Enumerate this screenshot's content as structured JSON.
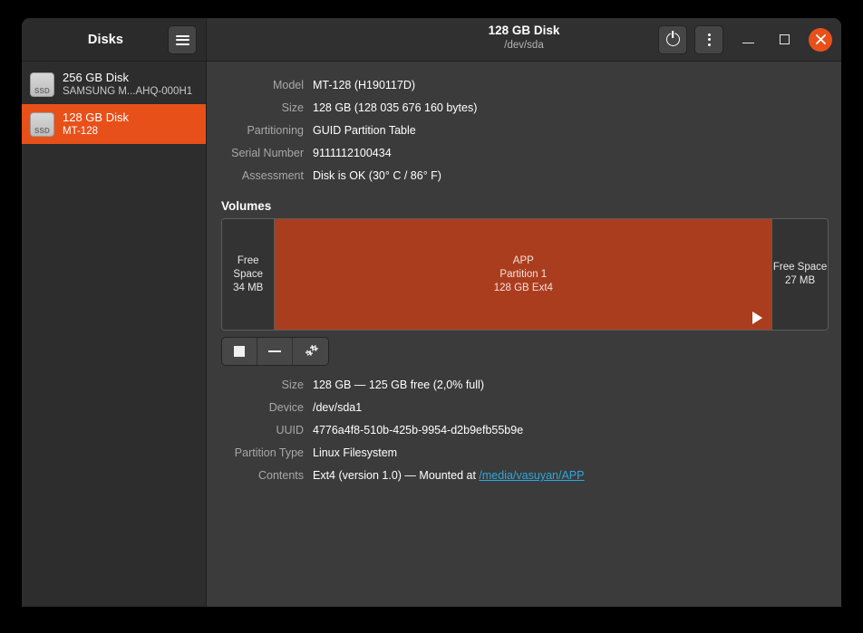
{
  "window": {
    "sidebar_title": "Disks",
    "title": "128 GB Disk",
    "subtitle": "/dev/sda",
    "menu_button_label": "Menu",
    "power_button_label": "Power off this disk",
    "more_button_label": "More options",
    "minimize_label": "Minimize",
    "maximize_label": "Maximize",
    "close_label": "Close"
  },
  "colors": {
    "accent": "#e8501a",
    "partition": "#ab3d1f",
    "link": "#2ca7e0",
    "sidebar_bg": "#2d2d2d",
    "content_bg": "#3b3b3b",
    "header_bg": "#303030"
  },
  "sidebar": {
    "disks": [
      {
        "title": "256 GB Disk",
        "subtitle": "SAMSUNG M...AHQ-000H1",
        "icon": "ssd-icon",
        "icon_label": "SSD",
        "selected": false
      },
      {
        "title": "128 GB Disk",
        "subtitle": "MT-128",
        "icon": "ssd-icon",
        "icon_label": "SSD",
        "selected": true
      }
    ]
  },
  "drive_info": {
    "rows": [
      {
        "label": "Model",
        "value": "MT-128 (H190117D)"
      },
      {
        "label": "Size",
        "value": "128 GB (128 035 676 160 bytes)"
      },
      {
        "label": "Partitioning",
        "value": "GUID Partition Table"
      },
      {
        "label": "Serial Number",
        "value": "9111112100434"
      },
      {
        "label": "Assessment",
        "value": "Disk is OK (30° C / 86° F)"
      }
    ]
  },
  "volumes": {
    "heading": "Volumes",
    "segments": [
      {
        "kind": "free",
        "line1": "Free Space",
        "line2": "34 MB",
        "line3": "",
        "width_pct": 8.6,
        "selected": false
      },
      {
        "kind": "partition",
        "line1": "APP",
        "line2": "Partition 1",
        "line3": "128 GB Ext4",
        "width_pct": 82.3,
        "selected": true
      },
      {
        "kind": "free",
        "line1": "Free Space",
        "line2": "27 MB",
        "line3": "",
        "width_pct": 9.1,
        "selected": false
      }
    ],
    "toolbar": [
      {
        "icon": "stop-icon",
        "label": "Unmount selected partition"
      },
      {
        "icon": "minus-icon",
        "label": "Delete selected partition"
      },
      {
        "icon": "gears-icon",
        "label": "Additional partition options"
      }
    ]
  },
  "volume_info": {
    "rows": [
      {
        "label": "Size",
        "value": "128 GB — 125 GB free (2,0% full)"
      },
      {
        "label": "Device",
        "value": "/dev/sda1"
      },
      {
        "label": "UUID",
        "value": "4776a4f8-510b-425b-9954-d2b9efb55b9e"
      },
      {
        "label": "Partition Type",
        "value": "Linux Filesystem"
      }
    ],
    "contents": {
      "label": "Contents",
      "prefix": "Ext4 (version 1.0) — Mounted at ",
      "link": "/media/vasuyan/APP"
    }
  }
}
